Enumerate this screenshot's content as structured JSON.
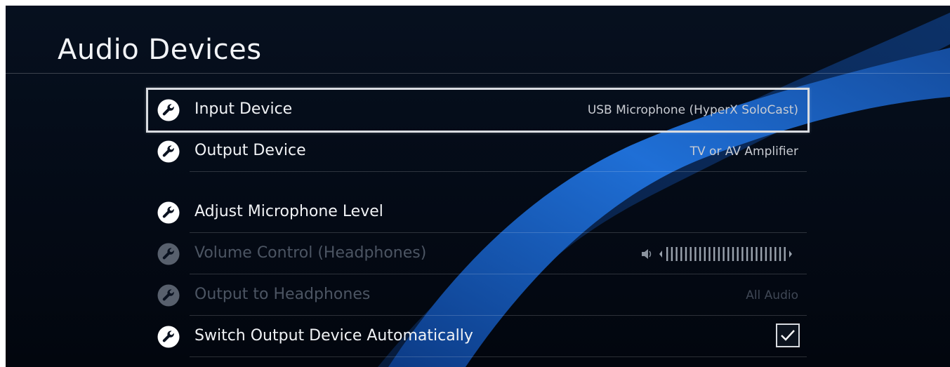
{
  "page": {
    "title": "Audio Devices"
  },
  "colors": {
    "accent_blue": "#1f6fd6",
    "background": "#050b16",
    "selection_border": "#d9dce1",
    "disabled_text": "#4c5563"
  },
  "menu": {
    "items": [
      {
        "label": "Input Device",
        "value": "USB Microphone (HyperX SoloCast)",
        "icon": "wrench-icon",
        "selected": true,
        "enabled": true
      },
      {
        "label": "Output Device",
        "value": "TV or AV Amplifier",
        "icon": "wrench-icon",
        "selected": false,
        "enabled": true
      },
      {
        "label": "Adjust Microphone Level",
        "value": "",
        "icon": "wrench-icon",
        "selected": false,
        "enabled": true
      },
      {
        "label": "Volume Control (Headphones)",
        "value": "",
        "icon": "wrench-icon",
        "selected": false,
        "enabled": false,
        "control": "volume-slider"
      },
      {
        "label": "Output to Headphones",
        "value": "All Audio",
        "icon": "wrench-icon",
        "selected": false,
        "enabled": false
      },
      {
        "label": "Switch Output Device Automatically",
        "value": "",
        "icon": "wrench-icon",
        "selected": false,
        "enabled": true,
        "control": "checkbox",
        "checked": true
      }
    ]
  },
  "volume_slider": {
    "level": 1.0,
    "icon": "speaker-icon"
  }
}
